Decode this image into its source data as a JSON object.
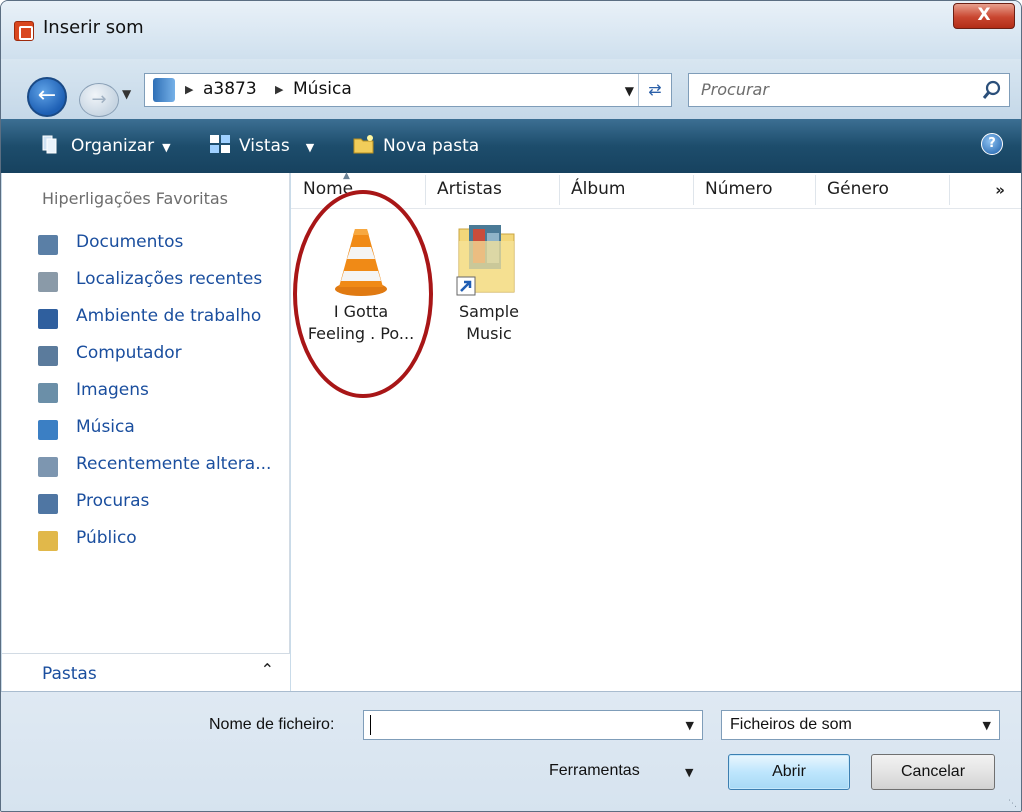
{
  "window": {
    "title": "Inserir som",
    "close_label": "X"
  },
  "address_bar": {
    "breadcrumb": [
      "a3873",
      "Música"
    ],
    "search_placeholder": "Procurar"
  },
  "toolbar": {
    "organize": "Organizar",
    "views": "Vistas",
    "new_folder": "Nova pasta",
    "help": "?"
  },
  "navigation": {
    "favorites_header": "Hiperligações Favoritas",
    "items": [
      {
        "label": "Documentos",
        "icon": "documents-icon",
        "color": "#5a7fa6"
      },
      {
        "label": "Localizações recentes",
        "icon": "recent-places-icon",
        "color": "#8a9aa8"
      },
      {
        "label": "Ambiente de trabalho",
        "icon": "desktop-icon",
        "color": "#2f5f9e"
      },
      {
        "label": "Computador",
        "icon": "computer-icon",
        "color": "#5b7b9c"
      },
      {
        "label": "Imagens",
        "icon": "pictures-icon",
        "color": "#6b8fa8"
      },
      {
        "label": "Música",
        "icon": "music-icon",
        "color": "#3b7fc4"
      },
      {
        "label": "Recentemente altera...",
        "icon": "recently-changed-icon",
        "color": "#7d96b0"
      },
      {
        "label": "Procuras",
        "icon": "searches-icon",
        "color": "#4f76a3"
      },
      {
        "label": "Público",
        "icon": "public-folder-icon",
        "color": "#e1b84a"
      }
    ],
    "folders_label": "Pastas"
  },
  "file_view": {
    "columns": [
      "Nome",
      "Artistas",
      "Álbum",
      "Número",
      "Género"
    ],
    "more_columns": "»",
    "items": [
      {
        "name_line1": "I Gotta",
        "name_line2": "Feeling . Po...",
        "icon": "vlc-cone-icon"
      },
      {
        "name_line1": "Sample",
        "name_line2": "Music",
        "icon": "folder-shortcut-icon"
      }
    ]
  },
  "bottom": {
    "filename_label": "Nome de ficheiro:",
    "filename_value": "",
    "file_type": "Ficheiros de som",
    "tools": "Ferramentas",
    "open": "Abrir",
    "cancel": "Cancelar"
  }
}
